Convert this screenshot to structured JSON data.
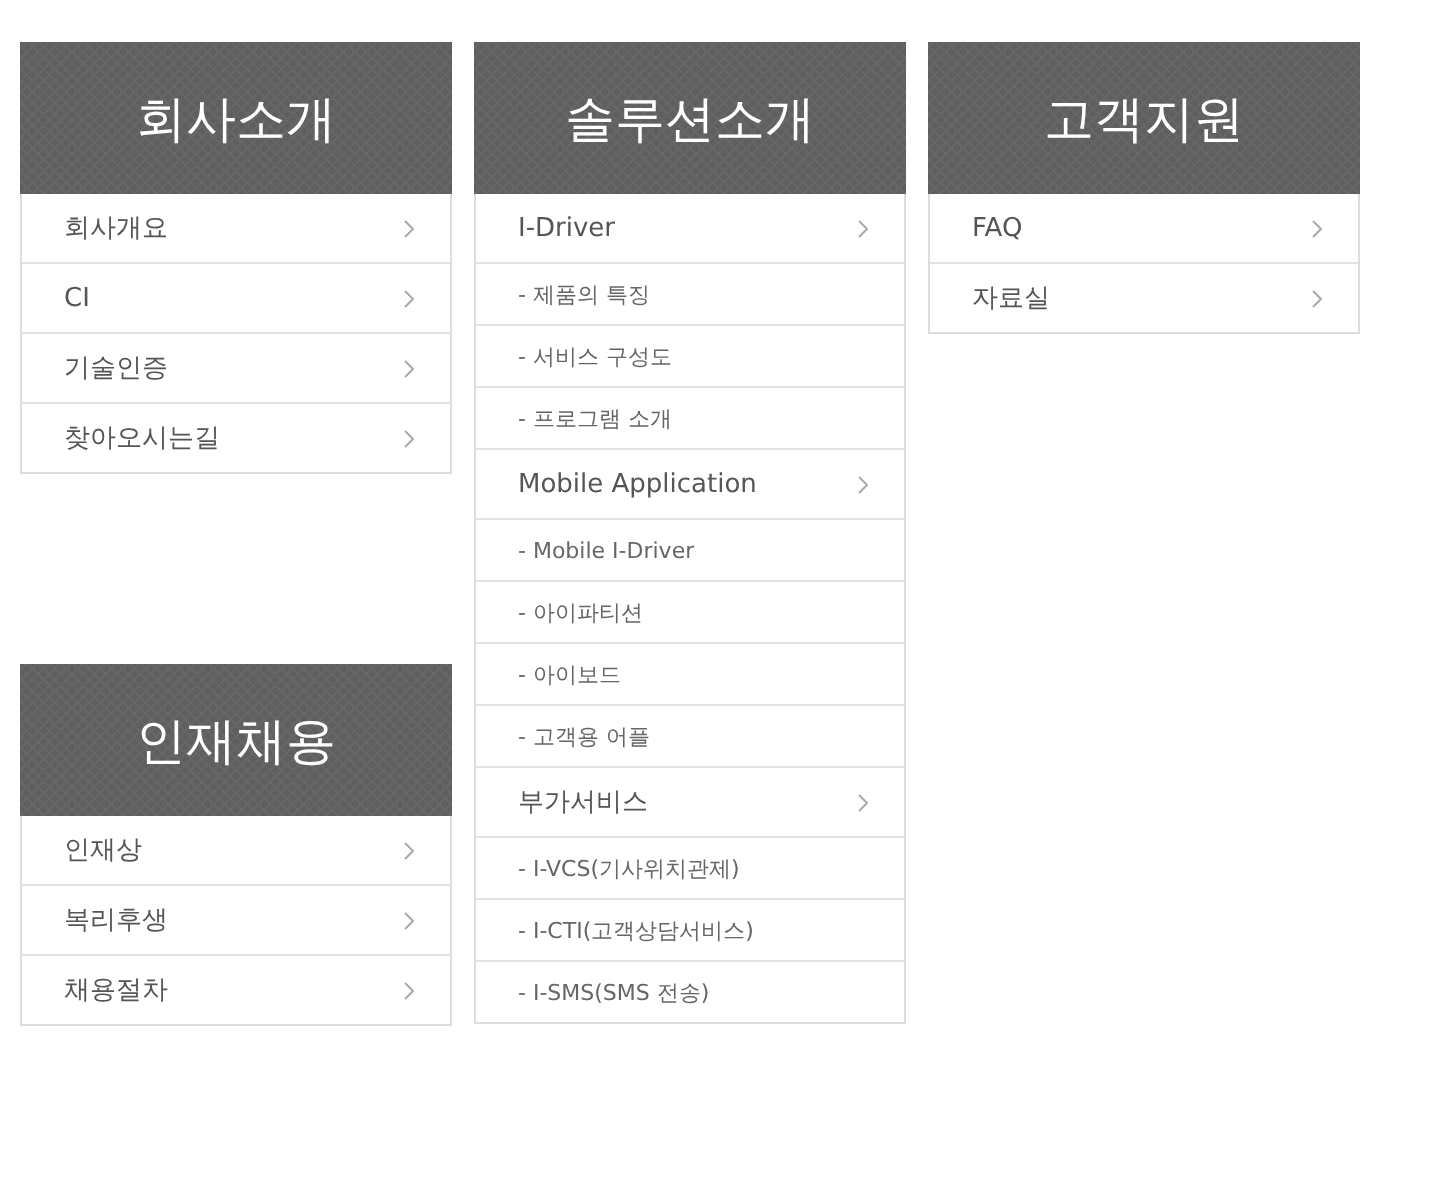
{
  "columns": [
    {
      "menus": [
        {
          "title": "회사소개",
          "items": [
            {
              "label": "회사개요",
              "kind": "main"
            },
            {
              "label": "CI",
              "kind": "main"
            },
            {
              "label": "기술인증",
              "kind": "main"
            },
            {
              "label": "찾아오시는길",
              "kind": "main"
            }
          ]
        },
        {
          "title": "인재채용",
          "items": [
            {
              "label": "인재상",
              "kind": "main"
            },
            {
              "label": "복리후생",
              "kind": "main"
            },
            {
              "label": "채용절차",
              "kind": "main"
            }
          ]
        }
      ]
    },
    {
      "menus": [
        {
          "title": "솔루션소개",
          "items": [
            {
              "label": "I-Driver",
              "kind": "main"
            },
            {
              "label": "- 제품의 특징",
              "kind": "sub"
            },
            {
              "label": "- 서비스 구성도",
              "kind": "sub"
            },
            {
              "label": "- 프로그램 소개",
              "kind": "sub"
            },
            {
              "label": "Mobile Application",
              "kind": "main"
            },
            {
              "label": "- Mobile I-Driver",
              "kind": "sub"
            },
            {
              "label": "- 아이파티션",
              "kind": "sub"
            },
            {
              "label": "- 아이보드",
              "kind": "sub"
            },
            {
              "label": "- 고객용 어플",
              "kind": "sub"
            },
            {
              "label": "부가서비스",
              "kind": "main"
            },
            {
              "label": "- I-VCS(기사위치관제)",
              "kind": "sub"
            },
            {
              "label": "- I-CTI(고객상담서비스)",
              "kind": "sub"
            },
            {
              "label": "- I-SMS(SMS 전송)",
              "kind": "sub"
            }
          ]
        }
      ]
    },
    {
      "menus": [
        {
          "title": "고객지원",
          "items": [
            {
              "label": "FAQ",
              "kind": "main"
            },
            {
              "label": "자료실",
              "kind": "main"
            }
          ]
        }
      ]
    }
  ]
}
